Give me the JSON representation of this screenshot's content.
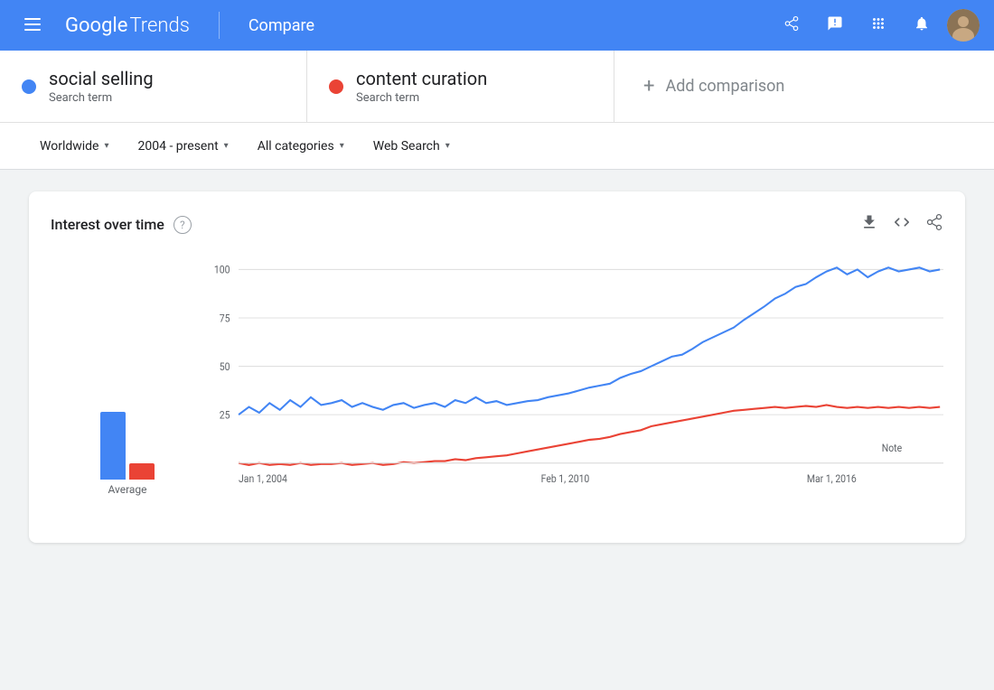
{
  "header": {
    "logo_google": "Google",
    "logo_trends": "Trends",
    "page_title": "Compare",
    "icons": {
      "menu": "☰",
      "share": "⎋",
      "feedback": "⚑",
      "apps": "⠿",
      "notifications": "🔔"
    }
  },
  "search_terms": [
    {
      "id": "term1",
      "name": "social selling",
      "type": "Search term",
      "dot_color": "#4285f4"
    },
    {
      "id": "term2",
      "name": "content curation",
      "type": "Search term",
      "dot_color": "#ea4335"
    }
  ],
  "add_comparison": {
    "label": "Add comparison",
    "icon": "+"
  },
  "filters": [
    {
      "id": "region",
      "label": "Worldwide",
      "selected": true
    },
    {
      "id": "time",
      "label": "2004 - present",
      "selected": true
    },
    {
      "id": "category",
      "label": "All categories",
      "selected": true
    },
    {
      "id": "search_type",
      "label": "Web Search",
      "selected": true
    }
  ],
  "chart": {
    "title": "Interest over time",
    "help_tooltip": "?",
    "y_axis_labels": [
      "100",
      "75",
      "50",
      "25"
    ],
    "x_axis_labels": [
      "Jan 1, 2004",
      "Feb 1, 2010",
      "Mar 1, 2016"
    ],
    "note_label": "Note",
    "avg_label": "Average",
    "avg_bar_blue_height": 75,
    "avg_bar_red_height": 18,
    "actions": {
      "download": "↓",
      "embed": "<>",
      "share": "⎋"
    }
  }
}
